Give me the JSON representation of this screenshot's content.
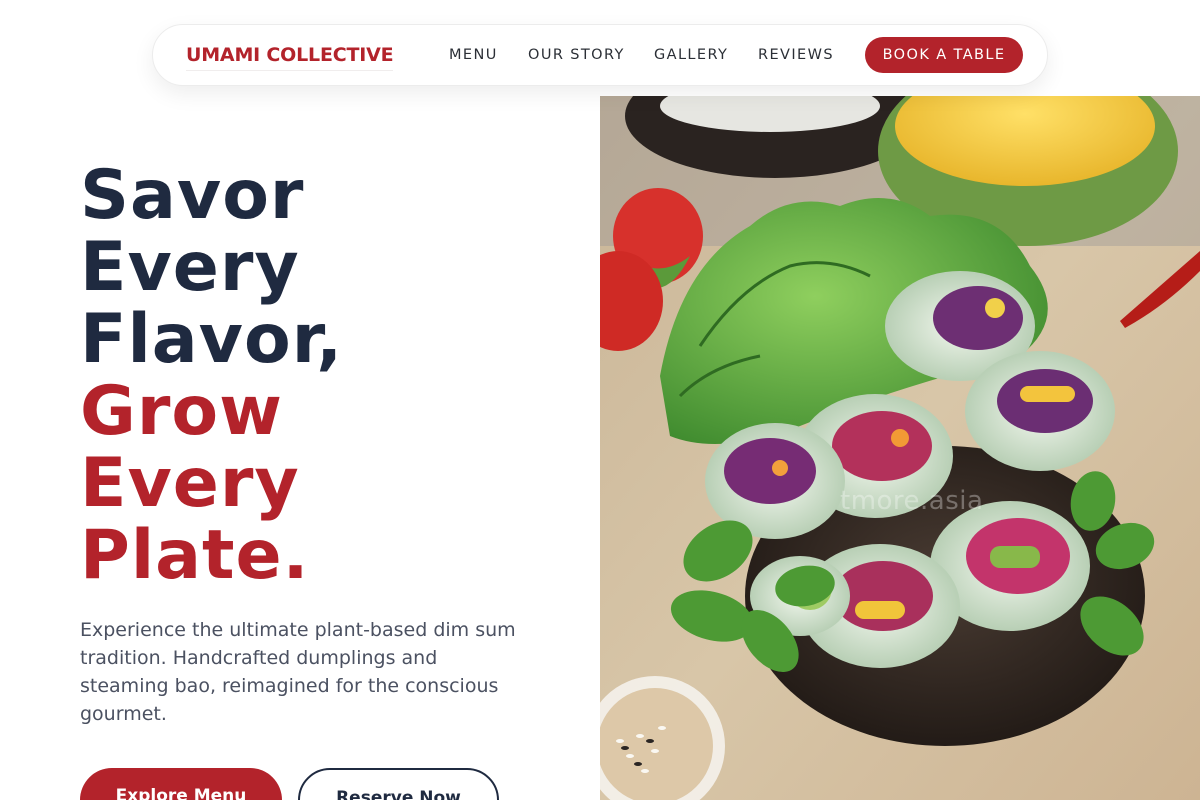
{
  "brand": {
    "name": "UMAMI COLLECTIVE"
  },
  "nav": {
    "links": [
      "MENU",
      "OUR STORY",
      "GALLERY",
      "REVIEWS"
    ],
    "cta": "BOOK A TABLE"
  },
  "hero": {
    "headline_dark": [
      "Savor",
      "Every",
      "Flavor,"
    ],
    "headline_accent": [
      "Grow",
      "Every",
      "Plate."
    ],
    "lead": "Experience the ultimate plant-based dim sum tradition. Handcrafted dumplings and steaming bao, reimagined for the conscious gourmet.",
    "primary_button": "Explore Menu",
    "secondary_button": "Reserve Now"
  },
  "image": {
    "watermark": "tmore.asia"
  },
  "colors": {
    "accent": "#b3232b",
    "dark": "#1f2a40",
    "body_text": "#4b5161"
  },
  "icons": {}
}
